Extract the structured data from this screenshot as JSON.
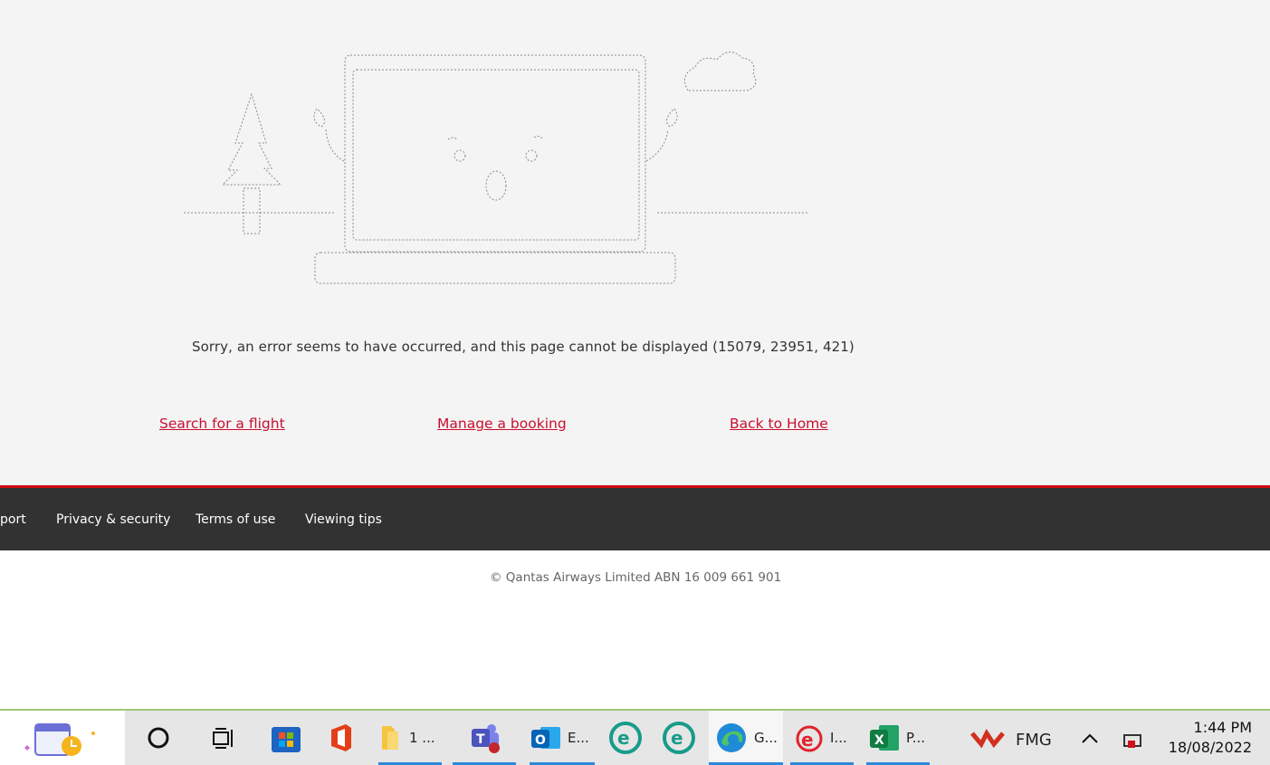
{
  "error": {
    "message": "Sorry, an error seems to have occurred, and this page cannot be displayed (15079, 23951, 421)"
  },
  "links": {
    "search_flight": "Search for a flight",
    "manage_booking": "Manage a booking",
    "back_home": "Back to Home"
  },
  "footer": {
    "links": [
      "port",
      "Privacy & security",
      "Terms of use",
      "Viewing tips"
    ],
    "copyright": "© Qantas Airways Limited ABN 16 009 661 901"
  },
  "taskbar": {
    "apps": [
      {
        "name": "files",
        "label": "1 ..."
      },
      {
        "name": "outlook",
        "label": "E..."
      },
      {
        "name": "edge",
        "label": "G..."
      },
      {
        "name": "ie",
        "label": "I..."
      },
      {
        "name": "excel",
        "label": "P..."
      }
    ],
    "tray_label": "FMG",
    "time": "1:44 PM",
    "date": "18/08/2022"
  },
  "colors": {
    "accent_red": "#c8102e",
    "footer_bg": "#323232",
    "footer_border": "#d10a14"
  }
}
